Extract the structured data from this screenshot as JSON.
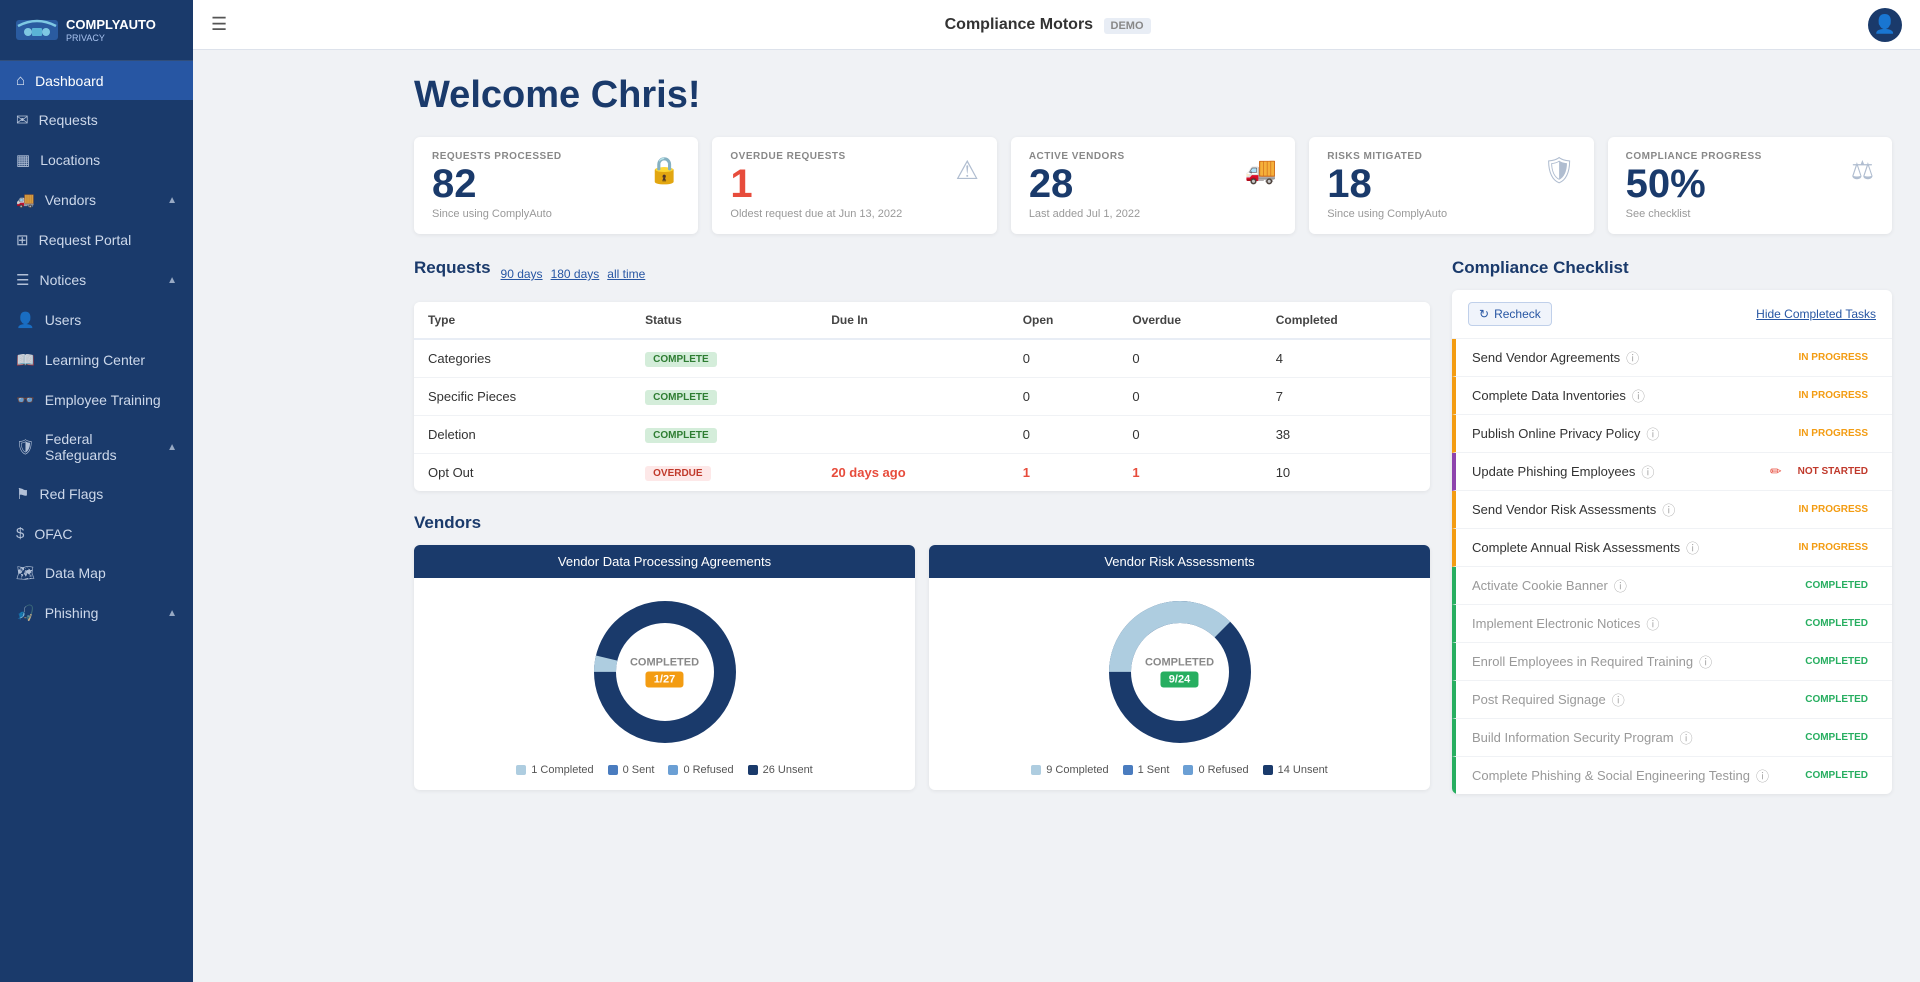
{
  "app": {
    "logo_text": "COMPLYAUTO",
    "logo_sub": "PRIVACY",
    "company_name": "Compliance Motors",
    "demo_label": "DEMO"
  },
  "sidebar": {
    "items": [
      {
        "id": "dashboard",
        "label": "Dashboard",
        "icon": "⌂",
        "active": true,
        "has_chevron": false
      },
      {
        "id": "requests",
        "label": "Requests",
        "icon": "✉",
        "active": false,
        "has_chevron": false
      },
      {
        "id": "locations",
        "label": "Locations",
        "icon": "▦",
        "active": false,
        "has_chevron": false
      },
      {
        "id": "vendors",
        "label": "Vendors",
        "icon": "🚚",
        "active": false,
        "has_chevron": true,
        "expanded": true
      },
      {
        "id": "request-portal",
        "label": "Request Portal",
        "icon": "⊞",
        "active": false,
        "has_chevron": false
      },
      {
        "id": "notices",
        "label": "Notices",
        "icon": "☰",
        "active": false,
        "has_chevron": true,
        "expanded": true
      },
      {
        "id": "users",
        "label": "Users",
        "icon": "👤",
        "active": false,
        "has_chevron": false
      },
      {
        "id": "learning-center",
        "label": "Learning Center",
        "icon": "📖",
        "active": false,
        "has_chevron": false
      },
      {
        "id": "employee-training",
        "label": "Employee Training",
        "icon": "👓",
        "active": false,
        "has_chevron": false
      },
      {
        "id": "federal-safeguards",
        "label": "Federal Safeguards",
        "icon": "🛡",
        "active": false,
        "has_chevron": true,
        "expanded": true
      },
      {
        "id": "red-flags",
        "label": "Red Flags",
        "icon": "⚑",
        "active": false,
        "has_chevron": false
      },
      {
        "id": "ofac",
        "label": "OFAC",
        "icon": "$",
        "active": false,
        "has_chevron": false
      },
      {
        "id": "data-map",
        "label": "Data Map",
        "icon": "🗺",
        "active": false,
        "has_chevron": false
      },
      {
        "id": "phishing",
        "label": "Phishing",
        "icon": "🎣",
        "active": false,
        "has_chevron": true,
        "expanded": true
      }
    ]
  },
  "welcome": {
    "title": "Welcome Chris!"
  },
  "stats": [
    {
      "id": "requests-processed",
      "label": "REQUESTS PROCESSED",
      "number": "82",
      "sub": "Since using ComplyAuto",
      "icon": "🔒"
    },
    {
      "id": "overdue-requests",
      "label": "OVERDUE REQUESTS",
      "number": "1",
      "sub": "Oldest request due at Jun 13, 2022",
      "icon": "⚠",
      "red": true
    },
    {
      "id": "active-vendors",
      "label": "ACTIVE VENDORS",
      "number": "28",
      "sub": "Last added Jul 1, 2022",
      "icon": "🚚"
    },
    {
      "id": "risks-mitigated",
      "label": "RISKS MITIGATED",
      "number": "18",
      "sub": "Since using ComplyAuto",
      "icon": "🛡"
    },
    {
      "id": "compliance-progress",
      "label": "COMPLIANCE PROGRESS",
      "number": "50%",
      "sub": "See checklist",
      "icon": "⚖"
    }
  ],
  "requests": {
    "section_title": "Requests",
    "date_links": [
      "90 days",
      "180 days",
      "all time"
    ],
    "columns": [
      "Type",
      "Status",
      "Due In",
      "Open",
      "Overdue",
      "Completed"
    ],
    "rows": [
      {
        "type": "Categories",
        "status": "COMPLETE",
        "status_type": "complete",
        "due_in": "",
        "open": "0",
        "overdue": "0",
        "completed": "4"
      },
      {
        "type": "Specific Pieces",
        "status": "COMPLETE",
        "status_type": "complete",
        "due_in": "",
        "open": "0",
        "overdue": "0",
        "completed": "7"
      },
      {
        "type": "Deletion",
        "status": "COMPLETE",
        "status_type": "complete",
        "due_in": "",
        "open": "0",
        "overdue": "0",
        "completed": "38"
      },
      {
        "type": "Opt Out",
        "status": "OVERDUE",
        "status_type": "overdue",
        "due_in": "20 days ago",
        "open": "1",
        "overdue": "1",
        "completed": "10"
      }
    ]
  },
  "vendors": {
    "section_title": "Vendors",
    "charts": [
      {
        "id": "dpa",
        "title": "Vendor Data Processing Agreements",
        "center_label": "COMPLETED",
        "badge_text": "1/27",
        "badge_type": "orange",
        "completed_ratio": 0.037,
        "legend": [
          {
            "label": "1 Completed",
            "color": "#aecde0"
          },
          {
            "label": "0 Sent",
            "color": "#4a7cbf"
          },
          {
            "label": "0 Refused",
            "color": "#6b9fd4"
          },
          {
            "label": "26 Unsent",
            "color": "#1a3a6b"
          }
        ]
      },
      {
        "id": "vra",
        "title": "Vendor Risk Assessments",
        "center_label": "COMPLETED",
        "badge_text": "9/24",
        "badge_type": "teal",
        "completed_ratio": 0.375,
        "legend": [
          {
            "label": "9 Completed",
            "color": "#aecde0"
          },
          {
            "label": "1 Sent",
            "color": "#4a7cbf"
          },
          {
            "label": "0 Refused",
            "color": "#6b9fd4"
          },
          {
            "label": "14 Unsent",
            "color": "#1a3a6b"
          }
        ]
      }
    ]
  },
  "compliance_checklist": {
    "section_title": "Compliance Checklist",
    "recheck_label": "Recheck",
    "hide_completed_label": "Hide Completed Tasks",
    "items": [
      {
        "id": "send-vendor-agreements",
        "label": "Send Vendor Agreements",
        "status": "IN PROGRESS",
        "status_type": "in-progress",
        "color": "yellow",
        "has_edit": false
      },
      {
        "id": "complete-data-inventories",
        "label": "Complete Data Inventories",
        "status": "IN PROGRESS",
        "status_type": "in-progress",
        "color": "yellow",
        "has_edit": false
      },
      {
        "id": "publish-online-privacy-policy",
        "label": "Publish Online Privacy Policy",
        "status": "IN PROGRESS",
        "status_type": "in-progress",
        "color": "yellow",
        "has_edit": false
      },
      {
        "id": "update-phishing-employees",
        "label": "Update Phishing Employees",
        "status": "NOT STARTED",
        "status_type": "not-started",
        "color": "purple",
        "has_edit": true
      },
      {
        "id": "send-vendor-risk-assessments",
        "label": "Send Vendor Risk Assessments",
        "status": "IN PROGRESS",
        "status_type": "in-progress",
        "color": "yellow",
        "has_edit": false
      },
      {
        "id": "complete-annual-risk-assessments",
        "label": "Complete Annual Risk Assessments",
        "status": "IN PROGRESS",
        "status_type": "in-progress",
        "color": "yellow",
        "has_edit": false
      },
      {
        "id": "activate-cookie-banner",
        "label": "Activate Cookie Banner",
        "status": "COMPLETED",
        "status_type": "completed",
        "color": "green",
        "has_edit": false
      },
      {
        "id": "implement-electronic-notices",
        "label": "Implement Electronic Notices",
        "status": "COMPLETED",
        "status_type": "completed",
        "color": "green",
        "has_edit": false
      },
      {
        "id": "enroll-employees-required-training",
        "label": "Enroll Employees in Required Training",
        "status": "COMPLETED",
        "status_type": "completed",
        "color": "green",
        "has_edit": false
      },
      {
        "id": "post-required-signage",
        "label": "Post Required Signage",
        "status": "COMPLETED",
        "status_type": "completed",
        "color": "green",
        "has_edit": false
      },
      {
        "id": "build-information-security-program",
        "label": "Build Information Security Program",
        "status": "COMPLETED",
        "status_type": "completed",
        "color": "green",
        "has_edit": false
      },
      {
        "id": "complete-phishing-social-engineering-testing",
        "label": "Complete Phishing & Social Engineering Testing",
        "status": "COMPLETED",
        "status_type": "completed",
        "color": "green",
        "has_edit": false
      }
    ]
  }
}
